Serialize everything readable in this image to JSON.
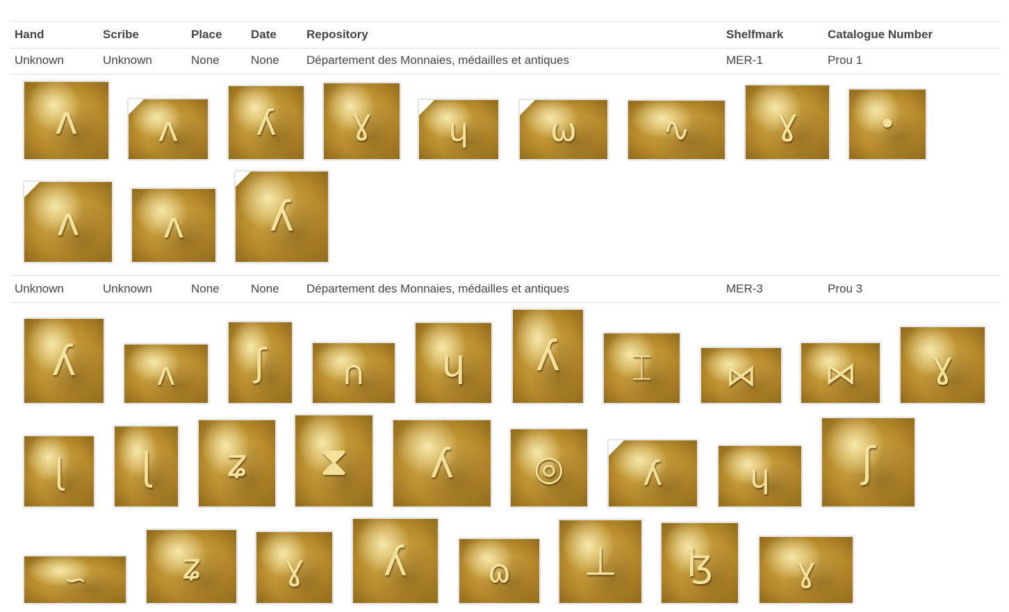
{
  "table": {
    "headers": {
      "hand": "Hand",
      "scribe": "Scribe",
      "place": "Place",
      "date": "Date",
      "repository": "Repository",
      "shelfmark": "Shelfmark",
      "catalogue_number": "Catalogue Number"
    },
    "rows": [
      {
        "hand": "Unknown",
        "scribe": "Unknown",
        "place": "None",
        "date": "None",
        "repository": "Département des Monnaies, médailles et antiques",
        "shelfmark": "MER-1",
        "catalogue_number": "Prou 1"
      },
      {
        "hand": "Unknown",
        "scribe": "Unknown",
        "place": "None",
        "date": "None",
        "repository": "Département des Monnaies, médailles et antiques",
        "shelfmark": "MER-3",
        "catalogue_number": "Prou 3"
      }
    ]
  },
  "colors": {
    "border": "#dddddd",
    "text": "#444444",
    "gold": "#c79c3a"
  }
}
